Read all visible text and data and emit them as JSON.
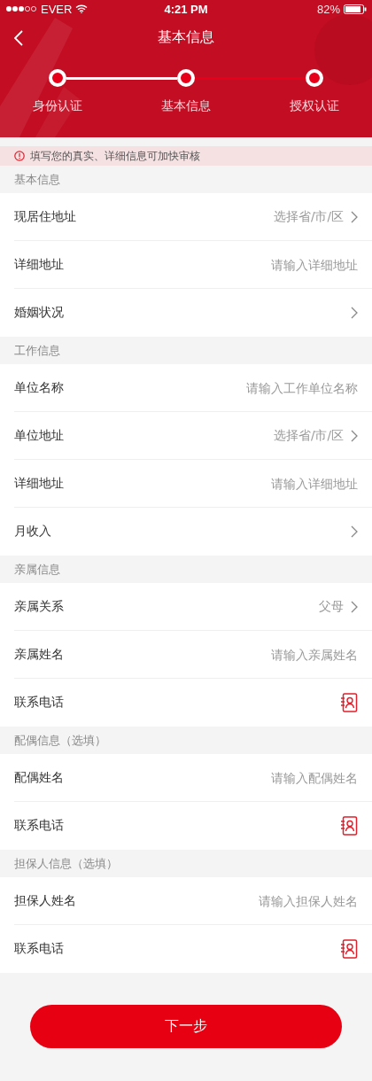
{
  "status_bar": {
    "carrier": "EVER",
    "time": "4:21 PM",
    "battery": "82%"
  },
  "nav": {
    "title": "基本信息"
  },
  "steps": [
    {
      "label": "身份认证"
    },
    {
      "label": "基本信息"
    },
    {
      "label": "授权认证"
    }
  ],
  "step_connectors": [
    {
      "completed": true
    },
    {
      "completed": false
    }
  ],
  "notice": "填写您的真实、详细信息可加快审核",
  "sections": [
    {
      "title": "基本信息",
      "rows": [
        {
          "kind": "select",
          "label": "现居住地址",
          "value": "选择省/市/区"
        },
        {
          "kind": "input",
          "label": "详细地址",
          "placeholder": "请输入详细地址"
        },
        {
          "kind": "select",
          "label": "婚姻状况"
        }
      ]
    },
    {
      "title": "工作信息",
      "rows": [
        {
          "kind": "input",
          "label": "单位名称",
          "placeholder": "请输入工作单位名称"
        },
        {
          "kind": "select",
          "label": "单位地址",
          "value": "选择省/市/区"
        },
        {
          "kind": "input",
          "label": "详细地址",
          "placeholder": "请输入详细地址"
        },
        {
          "kind": "select",
          "label": "月收入"
        }
      ]
    },
    {
      "title": "亲属信息",
      "rows": [
        {
          "kind": "select",
          "label": "亲属关系",
          "value": "父母"
        },
        {
          "kind": "input",
          "label": "亲属姓名",
          "placeholder": "请输入亲属姓名"
        },
        {
          "kind": "contact",
          "label": "联系电话"
        }
      ]
    },
    {
      "title": "配偶信息（选填）",
      "rows": [
        {
          "kind": "input",
          "label": "配偶姓名",
          "placeholder": "请输入配偶姓名"
        },
        {
          "kind": "contact",
          "label": "联系电话"
        }
      ]
    },
    {
      "title": "担保人信息（选填）",
      "rows": [
        {
          "kind": "input",
          "label": "担保人姓名",
          "placeholder": "请输入担保人姓名"
        },
        {
          "kind": "contact",
          "label": "联系电话"
        }
      ]
    }
  ],
  "next_button": "下一步"
}
